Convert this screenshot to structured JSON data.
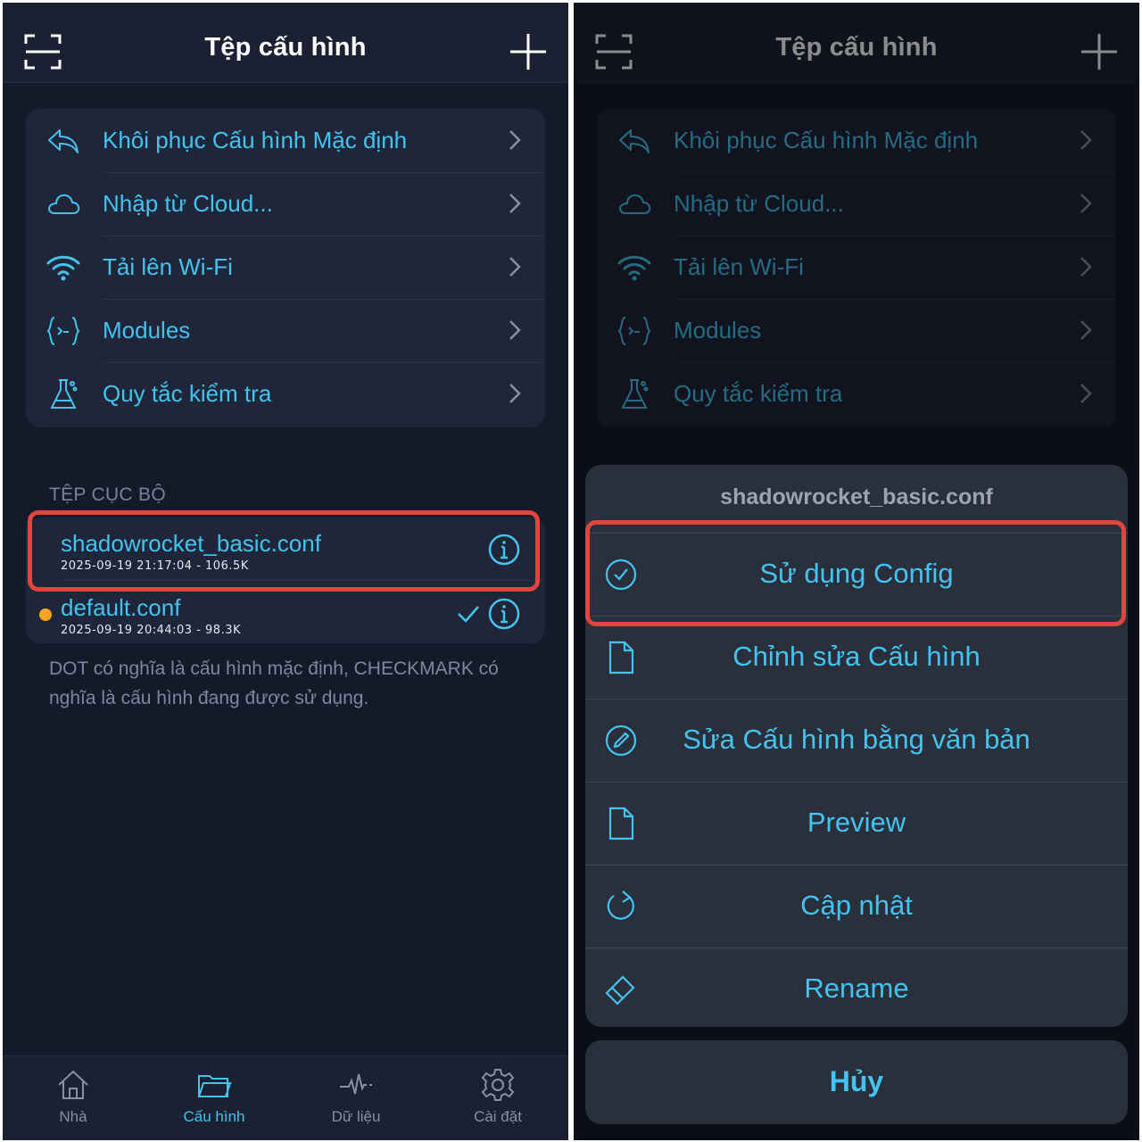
{
  "screen": {
    "title": "Tệp cấu hình",
    "menu": [
      {
        "label": "Khôi phục Cấu hình Mặc định",
        "icon": "reply-icon"
      },
      {
        "label": "Nhập từ Cloud...",
        "icon": "cloud-icon"
      },
      {
        "label": "Tải lên Wi-Fi",
        "icon": "wifi-icon"
      },
      {
        "label": "Modules",
        "icon": "code-braces-icon"
      },
      {
        "label": "Quy tắc kiểm tra",
        "icon": "flask-icon"
      }
    ],
    "local_section_header": "TỆP CỤC BỘ",
    "files": [
      {
        "name": "shadowrocket_basic.conf",
        "meta": "2025-09-19 21:17:04 - 106.5K"
      },
      {
        "name": "default.conf",
        "meta": "2025-09-19 20:44:03 - 98.3K"
      }
    ],
    "footnote": "DOT có nghĩa là cấu hình mặc định, CHECKMARK có nghĩa là cấu hình đang được sử dụng.",
    "tabs": [
      {
        "label": "Nhà",
        "icon": "home-icon"
      },
      {
        "label": "Cấu hình",
        "icon": "folder-icon"
      },
      {
        "label": "Dữ liệu",
        "icon": "pulse-icon"
      },
      {
        "label": "Cài đặt",
        "icon": "gear-icon"
      }
    ]
  },
  "action_sheet": {
    "title": "shadowrocket_basic.conf",
    "actions": [
      {
        "label": "Sử dụng Config",
        "icon": "check-circle-icon"
      },
      {
        "label": "Chỉnh sửa Cấu hình",
        "icon": "document-icon"
      },
      {
        "label": "Sửa Cấu hình bằng văn bản",
        "icon": "pencil-circle-icon"
      },
      {
        "label": "Preview",
        "icon": "document-icon"
      },
      {
        "label": "Cập nhật",
        "icon": "refresh-icon"
      },
      {
        "label": "Rename",
        "icon": "eraser-icon"
      }
    ],
    "cancel": "Hủy"
  },
  "colors": {
    "accent": "#43c3ef",
    "background": "#151a2a",
    "card": "#1f2639",
    "highlight": "#e1453b",
    "default_dot": "#f5a623"
  }
}
